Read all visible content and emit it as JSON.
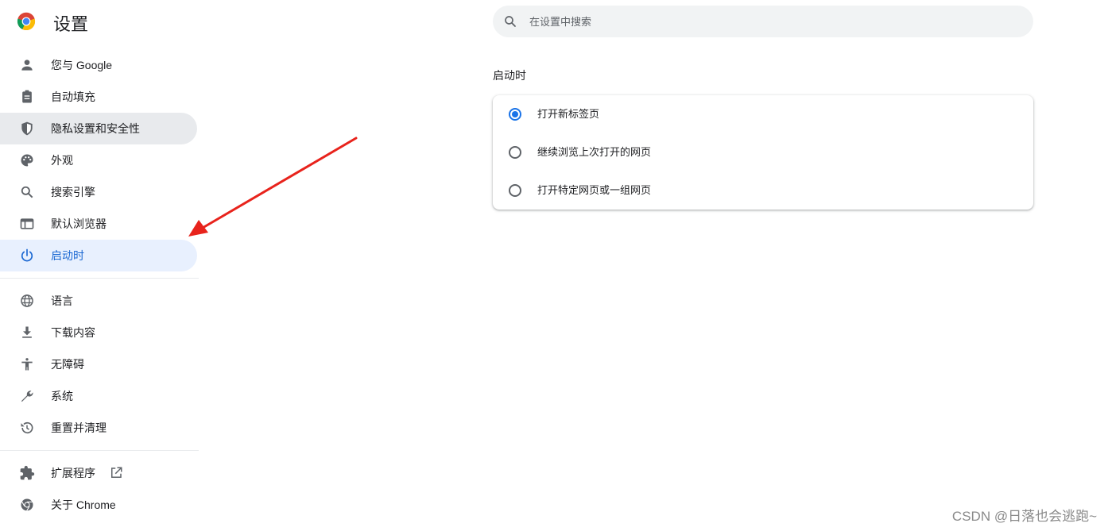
{
  "app": {
    "title": "设置"
  },
  "search": {
    "placeholder": "在设置中搜索"
  },
  "nav": {
    "group1": [
      {
        "label": "您与 Google",
        "icon": "person-icon"
      },
      {
        "label": "自动填充",
        "icon": "clipboard-icon"
      },
      {
        "label": "隐私设置和安全性",
        "icon": "shield-icon",
        "state": "hover"
      },
      {
        "label": "外观",
        "icon": "palette-icon"
      },
      {
        "label": "搜索引擎",
        "icon": "search-icon"
      },
      {
        "label": "默认浏览器",
        "icon": "browser-icon"
      },
      {
        "label": "启动时",
        "icon": "power-icon",
        "state": "active"
      }
    ],
    "group2": [
      {
        "label": "语言",
        "icon": "globe-icon"
      },
      {
        "label": "下载内容",
        "icon": "download-icon"
      },
      {
        "label": "无障碍",
        "icon": "accessibility-icon"
      },
      {
        "label": "系统",
        "icon": "wrench-icon"
      },
      {
        "label": "重置并清理",
        "icon": "history-icon"
      }
    ],
    "group3": [
      {
        "label": "扩展程序",
        "icon": "puzzle-icon",
        "trailing_icon": "open-external-icon"
      },
      {
        "label": "关于 Chrome",
        "icon": "chrome-icon"
      }
    ]
  },
  "startup": {
    "title": "启动时",
    "options": [
      {
        "label": "打开新标签页",
        "checked": true
      },
      {
        "label": "继续浏览上次打开的网页",
        "checked": false
      },
      {
        "label": "打开特定网页或一组网页",
        "checked": false
      }
    ]
  },
  "annotation": {
    "arrow_color": "#e8231c"
  },
  "colors": {
    "accent": "#1a73e8",
    "active_bg": "#e8f0fe",
    "hover_bg": "#e8eaed"
  },
  "watermark": "CSDN @日落也会逃跑~"
}
